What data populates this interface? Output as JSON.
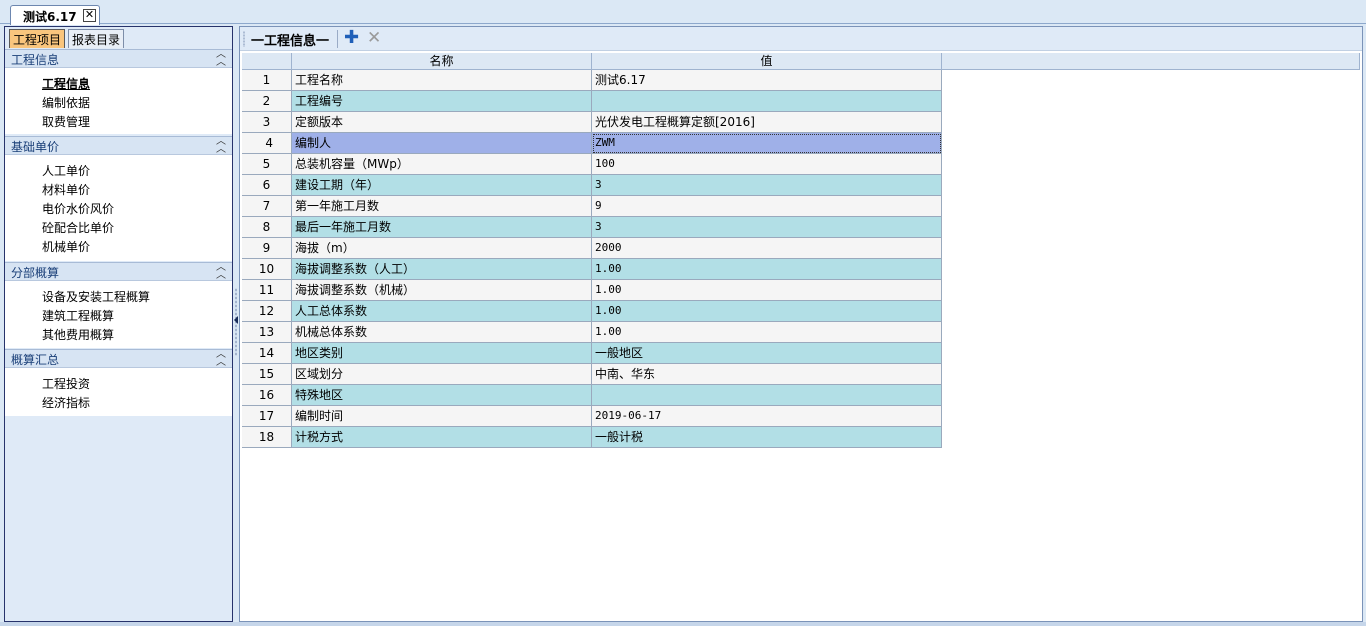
{
  "document_tab": {
    "label": "测试6.17",
    "close": "✕"
  },
  "left_panel": {
    "tabs": [
      "工程项目",
      "报表目录"
    ],
    "sections": [
      {
        "title": "工程信息",
        "items": [
          "工程信息",
          "编制依据",
          "取费管理"
        ]
      },
      {
        "title": "基础单价",
        "items": [
          "人工单价",
          "材料单价",
          "电价水价风价",
          "砼配合比单价",
          "机械单价"
        ]
      },
      {
        "title": "分部概算",
        "items": [
          "设备及安装工程概算",
          "建筑工程概算",
          "其他费用概算"
        ]
      },
      {
        "title": "概算汇总",
        "items": [
          "工程投资",
          "经济指标"
        ]
      }
    ],
    "selected_item": "工程信息"
  },
  "main": {
    "toolbar_title": "一工程信息一",
    "icons": {
      "add": "plus-icon",
      "delete": "delete-icon"
    },
    "grid": {
      "columns": [
        "名称",
        "值"
      ],
      "selected_row": 4,
      "rows": [
        {
          "idx": "1",
          "name": "工程名称",
          "value": "测试6.17"
        },
        {
          "idx": "2",
          "name": "工程编号",
          "value": ""
        },
        {
          "idx": "3",
          "name": "定额版本",
          "value": "光伏发电工程概算定额[2016]"
        },
        {
          "idx": "4",
          "name": "编制人",
          "value": "ZWM"
        },
        {
          "idx": "5",
          "name": "总装机容量（MWp）",
          "value": "100"
        },
        {
          "idx": "6",
          "name": "建设工期（年）",
          "value": "3"
        },
        {
          "idx": "7",
          "name": "第一年施工月数",
          "value": "9"
        },
        {
          "idx": "8",
          "name": "最后一年施工月数",
          "value": "3"
        },
        {
          "idx": "9",
          "name": "海拔（m）",
          "value": "2000"
        },
        {
          "idx": "10",
          "name": "海拔调整系数（人工）",
          "value": "1.00"
        },
        {
          "idx": "11",
          "name": "海拔调整系数（机械）",
          "value": "1.00"
        },
        {
          "idx": "12",
          "name": "人工总体系数",
          "value": "1.00"
        },
        {
          "idx": "13",
          "name": "机械总体系数",
          "value": "1.00"
        },
        {
          "idx": "14",
          "name": "地区类别",
          "value": "一般地区"
        },
        {
          "idx": "15",
          "name": "区域划分",
          "value": "中南、华东"
        },
        {
          "idx": "16",
          "name": "特殊地区",
          "value": ""
        },
        {
          "idx": "17",
          "name": "编制时间",
          "value": "2019-06-17"
        },
        {
          "idx": "18",
          "name": "计税方式",
          "value": "一般计税"
        }
      ]
    }
  },
  "colors": {
    "active_tab": "#f9c57d",
    "row_odd": "#f5f5f5",
    "row_even": "#b2dfe6",
    "row_selected": "#9fb0e8",
    "panel_border": "#27336b"
  }
}
